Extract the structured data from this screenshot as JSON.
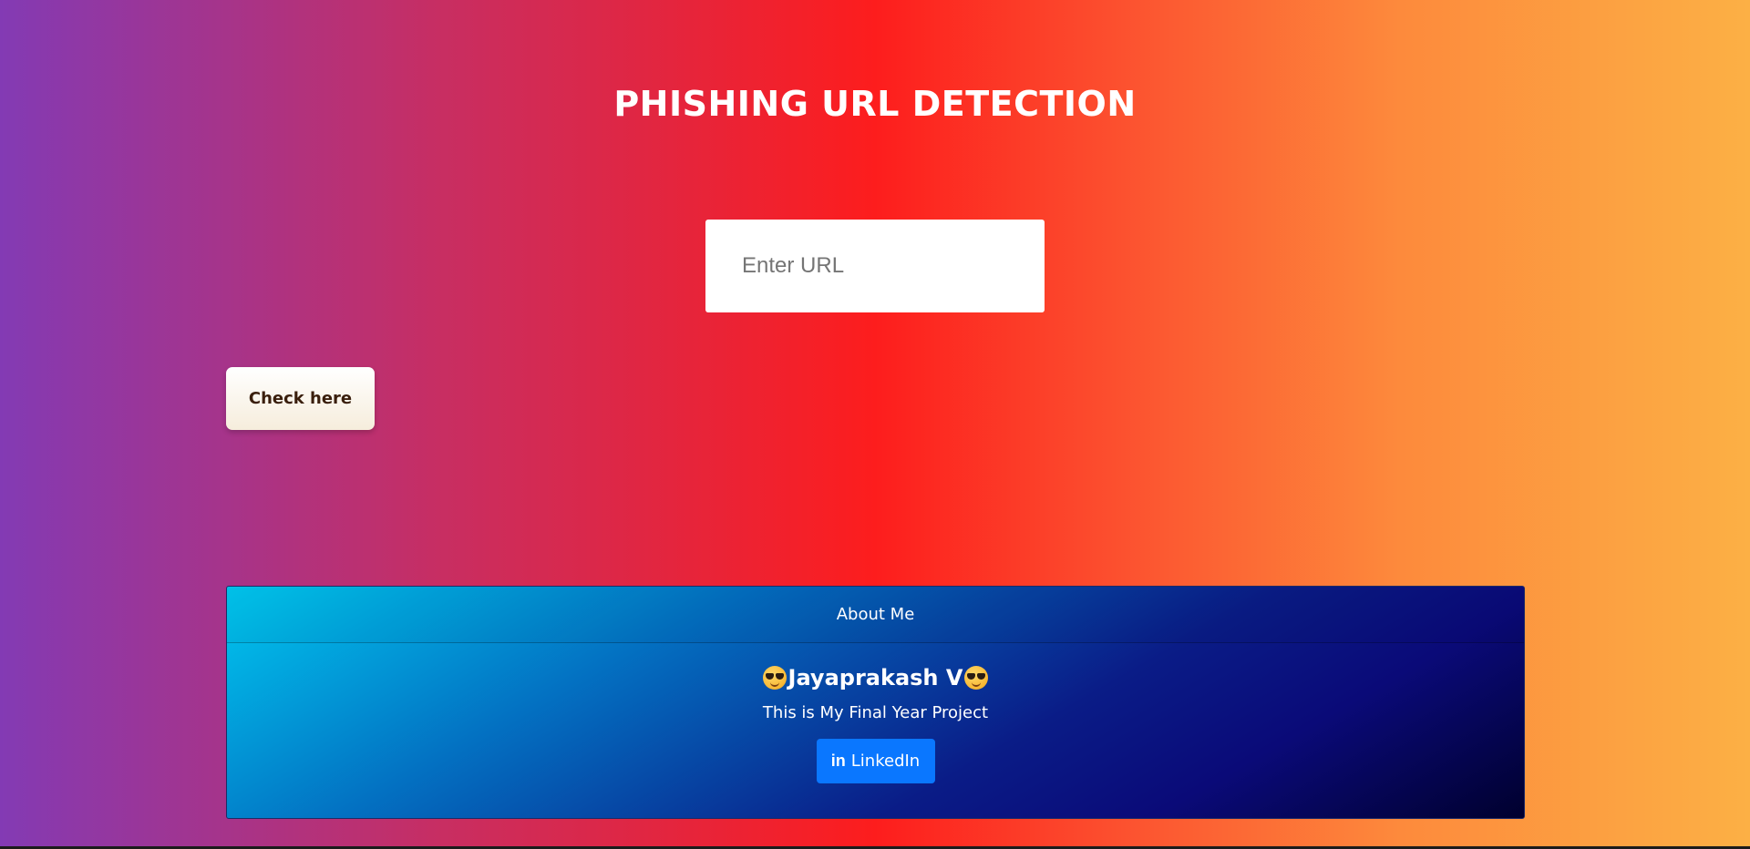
{
  "header": {
    "title": "PHISHING URL DETECTION"
  },
  "form": {
    "url_placeholder": "Enter URL",
    "url_value": "",
    "submit_label": "Check here"
  },
  "about": {
    "header": "About Me",
    "name": "Jayaprakash V",
    "name_icon": "smiling-face-with-sunglasses-icon",
    "description": "This is My Final Year Project",
    "linkedin_icon_text": "in",
    "linkedin_label": "LinkedIn"
  },
  "colors": {
    "gradient": [
      "#833ab4",
      "#fd1d1d",
      "#fcb045"
    ],
    "linkedin_button": "#0a77ff",
    "card_gradient": [
      "#00c8f0",
      "#0a1c87",
      "#00002e"
    ]
  }
}
